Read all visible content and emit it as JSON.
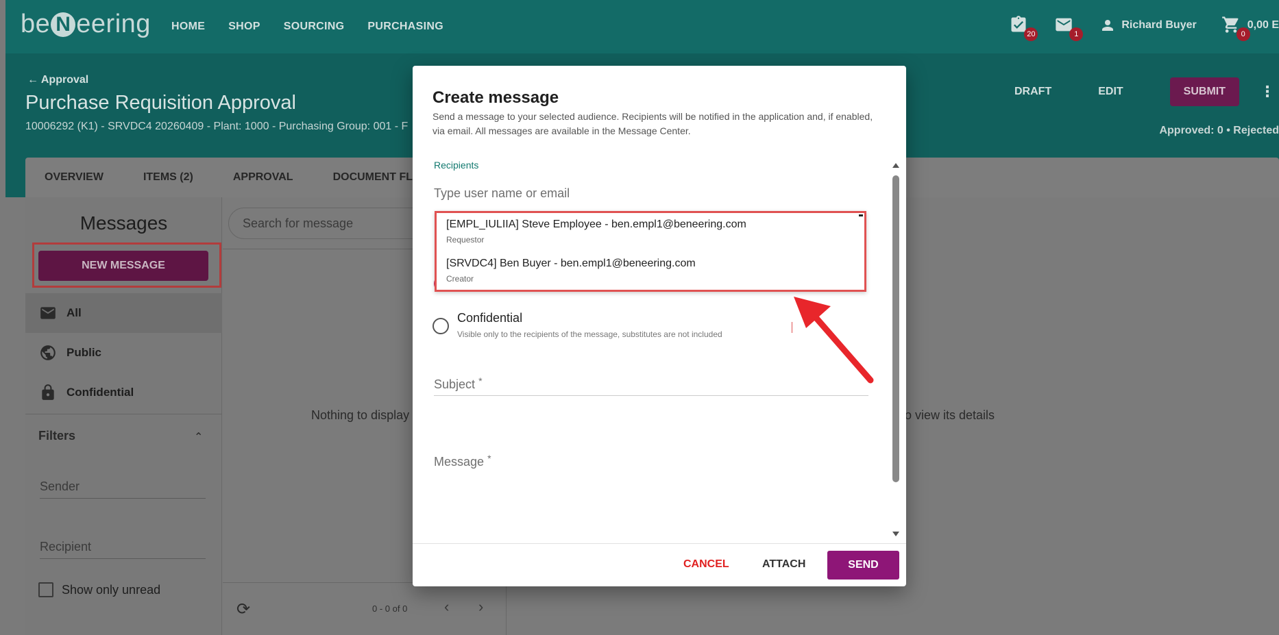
{
  "app": {
    "logo_text_before": "be",
    "logo_n": "N",
    "logo_text_after": "eering",
    "nav": [
      "HOME",
      "SHOP",
      "SOURCING",
      "PURCHASING"
    ],
    "tasks_badge": "20",
    "mail_badge": "1",
    "user_name": "Richard Buyer",
    "cart_badge": "0",
    "cart_total": "0,00 E"
  },
  "header": {
    "back_label": "Approval",
    "title": "Purchase Requisition Approval",
    "subtitle": "10006292 (K1) - SRVDC4 20260409 - Plant: 1000 - Purchasing Group: 001 - F",
    "draft_label": "DRAFT",
    "edit_label": "EDIT",
    "submit_label": "SUBMIT",
    "approved_status": "Approved: 0 • Rejected"
  },
  "tabs": [
    "OVERVIEW",
    "ITEMS (2)",
    "APPROVAL",
    "DOCUMENT FLO"
  ],
  "messages_panel": {
    "title": "Messages",
    "new_message_label": "NEW MESSAGE",
    "categories": [
      "All",
      "Public",
      "Confidential"
    ],
    "filters_label": "Filters",
    "sender_label": "Sender",
    "recipient_label": "Recipient",
    "show_unread_label": "Show only unread"
  },
  "list_panel": {
    "search_placeholder": "Search for message",
    "empty_text": "Nothing to display",
    "detail_hint": "o view its details",
    "pagination": "0 - 0 of 0"
  },
  "modal": {
    "title": "Create message",
    "description": "Send a message to your selected audience. Recipients will be notified in the application and, if enabled, via email. All messages are available in the Message Center.",
    "recipients_label": "Recipients",
    "recipients_placeholder": "Type user name or email",
    "suggestions": [
      {
        "main": "[EMPL_IULIIA] Steve Employee - ben.empl1@beneering.com",
        "role": "Requestor"
      },
      {
        "main": "[SRVDC4] Ben Buyer - ben.empl1@beneering.com",
        "role": "Creator"
      }
    ],
    "confidential_label": "Confidential",
    "confidential_desc": "Visible only to the recipients of the message, substitutes are not included",
    "subject_label": "Subject",
    "message_label": "Message",
    "required_mark": "*",
    "cancel_label": "CANCEL",
    "attach_label": "ATTACH",
    "send_label": "SEND"
  },
  "colors": {
    "teal": "#136b67",
    "purple": "#8e1677",
    "highlight_red": "#e05252"
  }
}
